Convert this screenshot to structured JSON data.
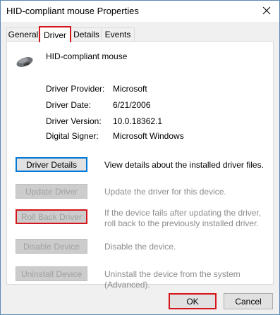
{
  "window": {
    "title": "HID-compliant mouse Properties"
  },
  "tabs": [
    {
      "label": "General"
    },
    {
      "label": "Driver"
    },
    {
      "label": "Details"
    },
    {
      "label": "Events"
    }
  ],
  "device": {
    "name": "HID-compliant mouse"
  },
  "info": [
    {
      "label": "Driver Provider:",
      "value": "Microsoft"
    },
    {
      "label": "Driver Date:",
      "value": "6/21/2006"
    },
    {
      "label": "Driver Version:",
      "value": "10.0.18362.1"
    },
    {
      "label": "Digital Signer:",
      "value": "Microsoft Windows"
    }
  ],
  "actions": [
    {
      "label": "Driver Details",
      "description": "View details about the installed driver files."
    },
    {
      "label": "Update Driver",
      "description": "Update the driver for this device."
    },
    {
      "label": "Roll Back Driver",
      "description": "If the device fails after updating the driver, roll back to the previously installed driver."
    },
    {
      "label": "Disable Device",
      "description": "Disable the device."
    },
    {
      "label": "Uninstall Device",
      "description": "Uninstall the device from the system (Advanced)."
    }
  ],
  "footer": {
    "ok_label": "OK",
    "cancel_label": "Cancel"
  },
  "colors": {
    "highlight": "#d4151b",
    "focus": "#0078d7"
  }
}
